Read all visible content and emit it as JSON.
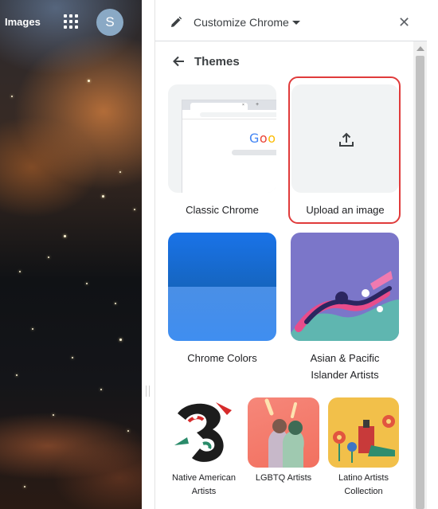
{
  "ntp": {
    "images_link": "Images",
    "apps_icon": "apps-grid-icon",
    "avatar_letter": "S"
  },
  "panel": {
    "title": "Customize Chrome",
    "section_title": "Themes",
    "close_symbol": "✕",
    "icons": {
      "edit": "pencil-icon",
      "menu": "dropdown-arrow-icon",
      "back": "arrow-back-icon",
      "upload": "upload-icon"
    }
  },
  "themes": [
    {
      "label": "Classic Chrome"
    },
    {
      "label": "Upload an image"
    },
    {
      "label": "Chrome Colors"
    },
    {
      "label_line1": "Asian & Pacific",
      "label_line2": "Islander Artists"
    },
    {
      "label_line1": "Native American",
      "label_line2": "Artists"
    },
    {
      "label": "LGBTQ Artists"
    },
    {
      "label_line1": "Latino Artists",
      "label_line2": "Collection"
    }
  ],
  "colors": {
    "highlight": "#e03b3b",
    "accent_blue": "#1a73e8"
  }
}
